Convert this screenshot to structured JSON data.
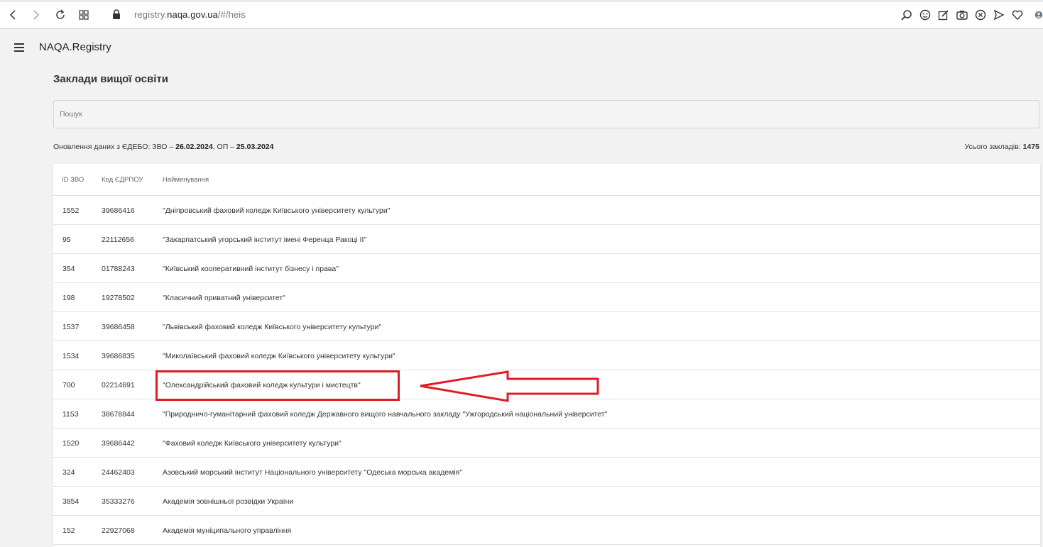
{
  "browser": {
    "url_prefix": "registry.",
    "url_domain": "naqa.gov.ua",
    "url_path": "/#/heis"
  },
  "header": {
    "app_title": "NAQA.Registry"
  },
  "page": {
    "title": "Заклади вищої освіти",
    "search_placeholder": "Пошук",
    "update_prefix": "Оновлення даних з ЄДЕБО: ЗВО – ",
    "update_zvo_date": "26.02.2024",
    "update_mid": ", ОП – ",
    "update_op_date": "25.03.2024",
    "total_label": "Усього закладів: ",
    "total_value": "1475"
  },
  "table": {
    "columns": [
      "ID ЗВО",
      "Код ЄДРПОУ",
      "Найменування"
    ],
    "rows": [
      {
        "id": "1552",
        "code": "39686416",
        "name": "\"Дніпровський фаховий коледж Київського університету культури\""
      },
      {
        "id": "95",
        "code": "22112656",
        "name": "\"Закарпатський угорський інститут імені Ференца Ракоці ІІ\""
      },
      {
        "id": "354",
        "code": "01788243",
        "name": "\"Київський кооперативний інститут бізнесу і права\""
      },
      {
        "id": "198",
        "code": "19278502",
        "name": "\"Класичний приватний університет\""
      },
      {
        "id": "1537",
        "code": "39686458",
        "name": "\"Львівський фаховий коледж Київського університету культури\""
      },
      {
        "id": "1534",
        "code": "39686835",
        "name": "\"Миколаївський фаховий коледж Київського університету культури\""
      },
      {
        "id": "700",
        "code": "02214691",
        "name": "\"Олександрійський фаховий коледж культури і мистецтв\""
      },
      {
        "id": "1153",
        "code": "38678844",
        "name": "\"Природничо-гуманітарний фаховий коледж Державного вищого навчального закладу \"Ужгородський національний університет\""
      },
      {
        "id": "1520",
        "code": "39686442",
        "name": "\"Фаховий коледж Київського університету культури\""
      },
      {
        "id": "324",
        "code": "24462403",
        "name": "Азовський морський інститут Національного університету \"Одеська морська академія\""
      },
      {
        "id": "3854",
        "code": "35333276",
        "name": "Академія зовнішньої розвідки України"
      },
      {
        "id": "152",
        "code": "22927068",
        "name": "Академія муніципального управління"
      }
    ]
  },
  "annotation": {
    "highlighted_row_id": "700",
    "color": "#e01b24"
  },
  "icons": [
    "back-icon",
    "forward-icon",
    "reload-icon",
    "tabs-grid-icon",
    "lock-icon",
    "search-page-icon",
    "emoji-icon",
    "edit-icon",
    "camera-icon",
    "close-circle-icon",
    "send-icon",
    "heart-icon",
    "profile-icon",
    "menu-icon"
  ]
}
